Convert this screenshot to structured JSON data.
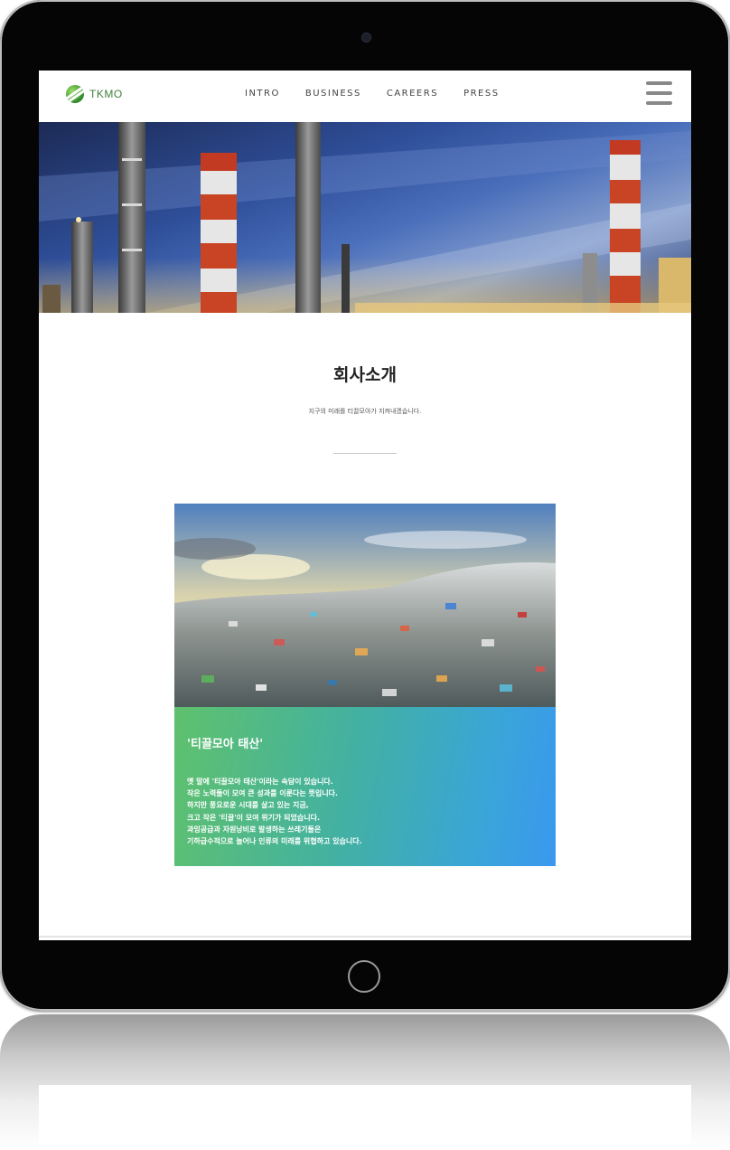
{
  "brand": {
    "name": "TKMO"
  },
  "nav": {
    "items": [
      "INTRO",
      "BUSINESS",
      "CAREERS",
      "PRESS"
    ]
  },
  "icons": {
    "menu": "hamburger-menu-icon",
    "logo": "tkmo-logo-icon"
  },
  "colors": {
    "brand_green": "#3f7f3a",
    "card_gradient_start": "#5fc16d",
    "card_gradient_end": "#3a98ef",
    "hamburger": "#888888"
  },
  "section": {
    "title": "회사소개",
    "subtitle": "지구의 미래를 티끌모아가 지켜내겠습니다."
  },
  "card": {
    "title": "'티끌모아 태산'",
    "lines": [
      "옛 말에 '티끌모아 태산'이라는 속담이 있습니다.",
      "작은 노력들이 모여 큰 성과를 이룬다는 뜻입니다.",
      "하지만 풍요로운 시대를 살고 있는 지금,",
      "크고 작은 '티끌'이 모여 위기가 되었습니다.",
      "과잉공급과 자원낭비로 발생하는 쓰레기들은",
      "기하급수적으로 늘어나 인류의 미래를 위협하고 있습니다."
    ]
  }
}
